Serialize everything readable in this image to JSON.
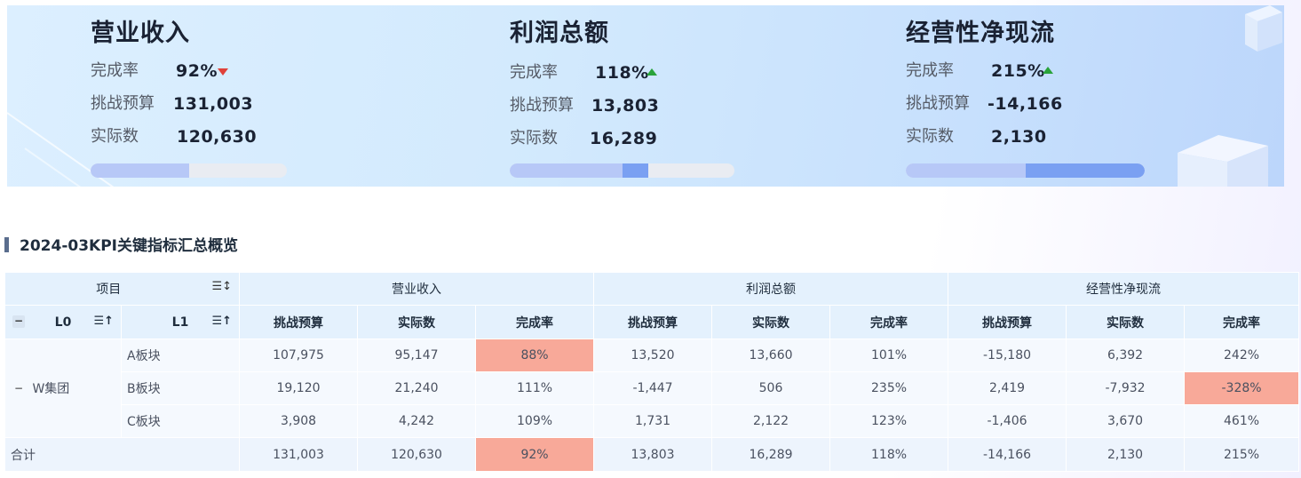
{
  "kpis": [
    {
      "title": "营业收入",
      "rate_label": "完成率",
      "rate_value": "92%",
      "trend": "down",
      "budget_label": "挑战预算",
      "budget_value": "131,003",
      "actual_label": "实际数",
      "actual_value": "120,630",
      "progress": {
        "completed": 0.5,
        "current": 0.0
      }
    },
    {
      "title": "利润总额",
      "rate_label": "完成率",
      "rate_value": "118%",
      "trend": "up",
      "budget_label": "挑战预算",
      "budget_value": "13,803",
      "actual_label": "实际数",
      "actual_value": "16,289",
      "progress": {
        "completed": 0.5,
        "current": 0.12
      }
    },
    {
      "title": "经营性净现流",
      "rate_label": "完成率",
      "rate_value": "215%",
      "trend": "up",
      "budget_label": "挑战预算",
      "budget_value": "-14,166",
      "actual_label": "实际数",
      "actual_value": "2,130",
      "progress": {
        "completed": 0.5,
        "current": 0.5
      }
    }
  ],
  "section_title": "2024-03KPI关键指标汇总概览",
  "table": {
    "h_item": "项目",
    "groups": [
      "营业收入",
      "利润总额",
      "经营性净现流"
    ],
    "h_l0": "L0",
    "h_l1": "L1",
    "sub_headers": [
      "挑战预算",
      "实际数",
      "完成率"
    ],
    "group_label": "W集团",
    "rows": [
      {
        "l1": "A板块",
        "cells": [
          "107,975",
          "95,147",
          "88%",
          "13,520",
          "13,660",
          "101%",
          "-15,180",
          "6,392",
          "242%"
        ]
      },
      {
        "l1": "B板块",
        "cells": [
          "19,120",
          "21,240",
          "111%",
          "-1,447",
          "506",
          "235%",
          "2,419",
          "-7,932",
          "-328%"
        ]
      },
      {
        "l1": "C板块",
        "cells": [
          "3,908",
          "4,242",
          "109%",
          "1,731",
          "2,122",
          "123%",
          "-1,406",
          "3,670",
          "461%"
        ]
      }
    ],
    "total_label": "合计",
    "total": [
      "131,003",
      "120,630",
      "92%",
      "13,803",
      "16,289",
      "118%",
      "-14,166",
      "2,130",
      "215%"
    ],
    "highlight_color": "#f8a999"
  },
  "colors": {
    "down_arrow": "#e0413a",
    "up_arrow": "#29a33a",
    "bar_light": "#b7c8f7",
    "bar_dark": "#7aa0f2"
  }
}
